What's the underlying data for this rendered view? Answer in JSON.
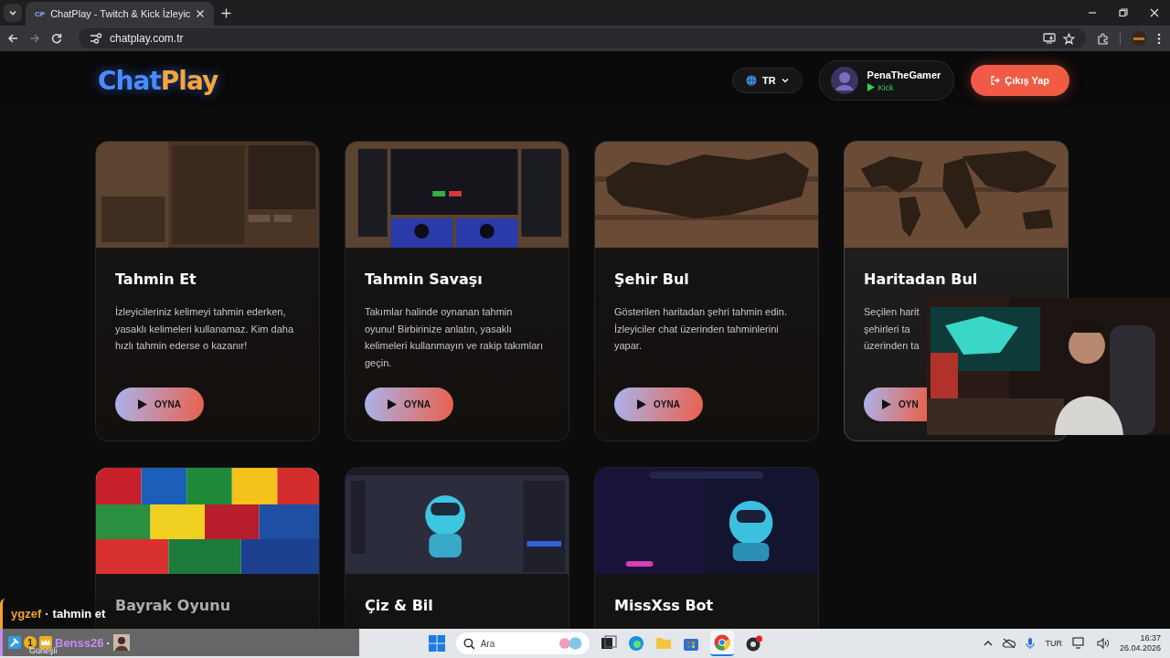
{
  "browser": {
    "tab": {
      "favicon": "CP",
      "title": "ChatPlay - Twitch & Kick İzleyic",
      "selected": true
    },
    "url": "chatplay.com.tr"
  },
  "header": {
    "logo": {
      "first": "Chat",
      "second": "Play"
    },
    "language": "TR",
    "user": {
      "name": "PenaTheGamer",
      "platform": "Kick"
    },
    "logout": "Çıkış Yap"
  },
  "games": [
    {
      "title": "Tahmin Et",
      "lines": [
        "İzleyicileriniz kelimeyi tahmin ederken,",
        "yasaklı kelimeleri kullanamaz. Kim daha",
        "hızlı tahmin ederse o kazanır!"
      ],
      "button": "OYNA",
      "highlighted": false,
      "thumbnail": {
        "kind": "picture"
      }
    },
    {
      "title": "Tahmin Savaşı",
      "lines": [
        "Takımlar halinde oynanan tahmin",
        "oyunu! Birbirinize anlatın, yasaklı",
        "kelimeleri kullanmayın ve rakip takımları",
        "geçin."
      ],
      "button": "OYNA",
      "highlighted": false,
      "thumbnail": {
        "kind": "picture"
      }
    },
    {
      "title": "Şehir Bul",
      "lines": [
        "Gösterilen haritadan şehri tahmin edin.",
        "İzleyiciler chat üzerinden tahminlerini",
        "yapar."
      ],
      "button": "OYNA",
      "highlighted": false,
      "thumbnail": {
        "kind": "picture"
      }
    },
    {
      "title": "Haritadan Bul",
      "lines": [
        "Seçilen harit",
        "şehirleri ta",
        "üzerinden ta"
      ],
      "button": "OYN",
      "highlighted": true,
      "thumbnail": {
        "kind": "picture"
      }
    },
    {
      "title": "Bayrak Oyunu",
      "highlighted": false,
      "thumbnail": {
        "kind": "picture"
      }
    },
    {
      "title": "Çiz & Bil",
      "highlighted": false,
      "thumbnail": {
        "kind": "picture"
      }
    },
    {
      "title": "MissXss Bot",
      "highlighted": false,
      "thumbnail": {
        "kind": "picture"
      }
    }
  ],
  "webcam": {
    "kind": "picture"
  },
  "chat": [
    {
      "user": "ygzef",
      "separator": "·",
      "message": "tahmin et",
      "color": "#f2a22c"
    },
    {
      "badge": "1",
      "user": "Benss26",
      "separator": "·",
      "color": "#c58cf5"
    }
  ],
  "taskbar": {
    "weather": "Güneşli",
    "search_label": "Ara",
    "language": "TUR",
    "time": "16:37",
    "date": "26.04.2026"
  }
}
